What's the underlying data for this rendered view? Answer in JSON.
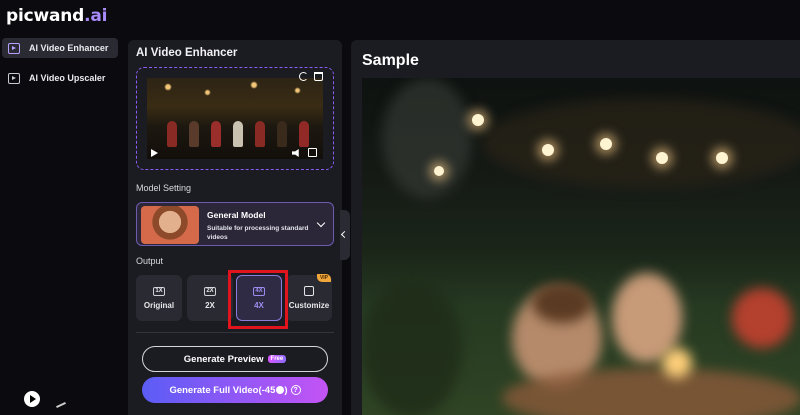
{
  "brand": {
    "name_main": "picwand",
    "name_suffix": ".ai"
  },
  "sidebar": {
    "items": [
      {
        "label": "AI Video Enhancer",
        "icon": "video-enhance-icon",
        "active": true
      },
      {
        "label": "AI Video Upscaler",
        "icon": "video-upscale-icon",
        "active": false
      }
    ]
  },
  "panel": {
    "title": "AI Video Enhancer",
    "model_section_label": "Model Setting",
    "model": {
      "name": "General Model",
      "description": "Suitable for processing standard videos"
    },
    "output_section_label": "Output",
    "output_options": [
      {
        "badge": "1X",
        "label": "Original"
      },
      {
        "badge": "2X",
        "label": "2X"
      },
      {
        "badge": "4X",
        "label": "4X",
        "selected": true
      },
      {
        "label": "Customize",
        "tag": "VIP"
      }
    ],
    "preview_button": {
      "label": "Generate Preview",
      "tag": "Free"
    },
    "full_button": {
      "label": "Generate Full Video(-45",
      "suffix": ")"
    }
  },
  "sample": {
    "title": "Sample"
  },
  "colors": {
    "accent": "#8b5cf6",
    "highlight": "#e0141c",
    "panel_bg": "#1b1b22"
  }
}
